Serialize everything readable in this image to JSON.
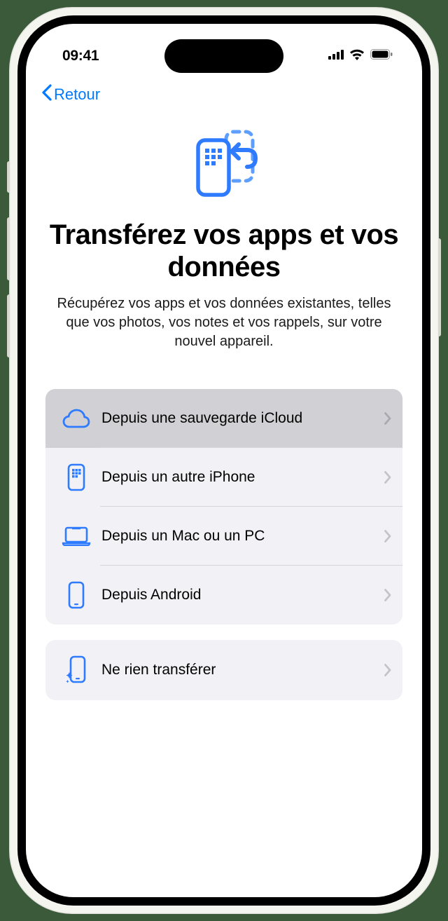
{
  "status": {
    "time": "09:41"
  },
  "nav": {
    "back_label": "Retour"
  },
  "header": {
    "title": "Transférez vos apps et vos données",
    "subtitle": "Récupérez vos apps et vos données existantes, telles que vos photos, vos notes et vos rappels, sur votre nouvel appareil."
  },
  "options_group_1": [
    {
      "id": "icloud",
      "label": "Depuis une sauvegarde iCloud",
      "icon": "cloud-icon",
      "selected": true
    },
    {
      "id": "iphone",
      "label": "Depuis un autre iPhone",
      "icon": "iphone-grid-icon",
      "selected": false
    },
    {
      "id": "mac-pc",
      "label": "Depuis un Mac ou un PC",
      "icon": "laptop-icon",
      "selected": false
    },
    {
      "id": "android",
      "label": "Depuis Android",
      "icon": "phone-icon",
      "selected": false
    }
  ],
  "options_group_2": [
    {
      "id": "none",
      "label": "Ne rien transférer",
      "icon": "phone-sparkle-icon",
      "selected": false
    }
  ],
  "colors": {
    "accent": "#007aff",
    "group_bg": "#f2f2f6",
    "selected_bg": "#d1d1d5"
  }
}
